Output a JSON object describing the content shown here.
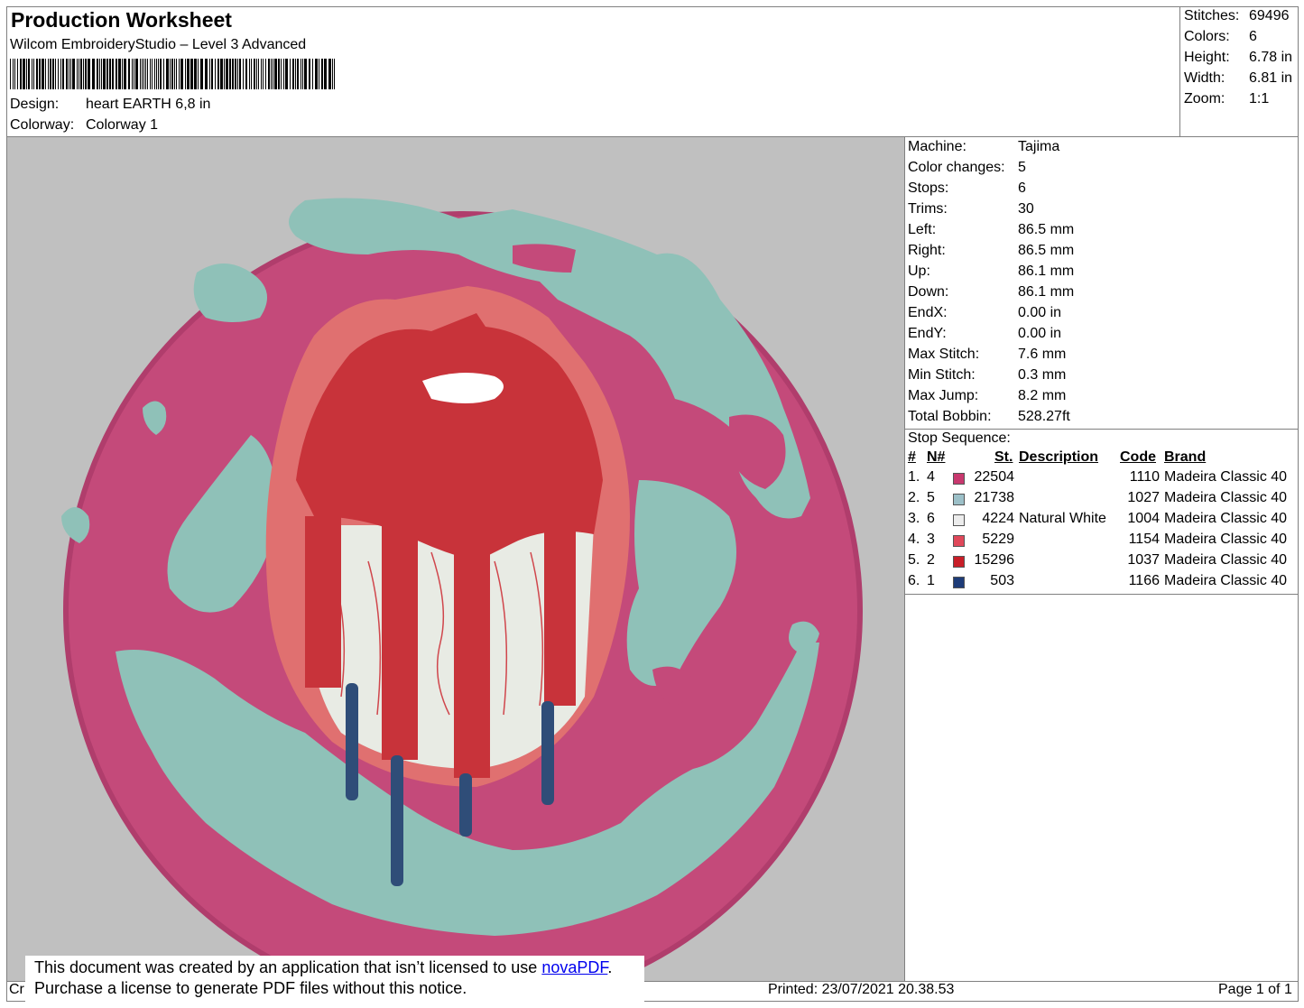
{
  "header": {
    "title": "Production Worksheet",
    "subtitle": "Wilcom EmbroideryStudio – Level 3 Advanced",
    "design_label": "Design:",
    "design_value": "heart EARTH 6,8 in",
    "colorway_label": "Colorway:",
    "colorway_value": "Colorway 1"
  },
  "summary": [
    {
      "label": "Stitches:",
      "value": "69496"
    },
    {
      "label": "Colors:",
      "value": "6"
    },
    {
      "label": "Height:",
      "value": "6.78 in"
    },
    {
      "label": "Width:",
      "value": "6.81 in"
    },
    {
      "label": "Zoom:",
      "value": "1:1"
    }
  ],
  "machine_info": [
    {
      "label": "Machine:",
      "value": "Tajima"
    },
    {
      "label": "Color changes:",
      "value": "5"
    },
    {
      "label": "Stops:",
      "value": "6"
    },
    {
      "label": "Trims:",
      "value": "30"
    },
    {
      "label": "Left:",
      "value": "86.5 mm"
    },
    {
      "label": "Right:",
      "value": "86.5 mm"
    },
    {
      "label": "Up:",
      "value": "86.1 mm"
    },
    {
      "label": "Down:",
      "value": "86.1 mm"
    },
    {
      "label": "EndX:",
      "value": "0.00 in"
    },
    {
      "label": "EndY:",
      "value": "0.00 in"
    },
    {
      "label": "Max Stitch:",
      "value": "7.6 mm"
    },
    {
      "label": "Min Stitch:",
      "value": "0.3 mm"
    },
    {
      "label": "Max Jump:",
      "value": "8.2 mm"
    },
    {
      "label": "Total Bobbin:",
      "value": "528.27ft"
    }
  ],
  "stop_sequence": {
    "label": "Stop Sequence:",
    "headers": {
      "num": "#",
      "n": "N#",
      "st": "St.",
      "description": "Description",
      "code": "Code",
      "brand": "Brand"
    },
    "rows": [
      {
        "num": "1.",
        "n": "4",
        "color": "#c8386e",
        "st": "22504",
        "description": "",
        "code": "1110",
        "brand": "Madeira Classic 40"
      },
      {
        "num": "2.",
        "n": "5",
        "color": "#9cc0c8",
        "st": "21738",
        "description": "",
        "code": "1027",
        "brand": "Madeira Classic 40"
      },
      {
        "num": "3.",
        "n": "6",
        "color": "#ececec",
        "st": "4224",
        "description": "Natural White",
        "code": "1004",
        "brand": "Madeira Classic 40"
      },
      {
        "num": "4.",
        "n": "3",
        "color": "#e0485a",
        "st": "5229",
        "description": "",
        "code": "1154",
        "brand": "Madeira Classic 40"
      },
      {
        "num": "5.",
        "n": "2",
        "color": "#c81e28",
        "st": "15296",
        "description": "",
        "code": "1037",
        "brand": "Madeira Classic 40"
      },
      {
        "num": "6.",
        "n": "1",
        "color": "#1e3c78",
        "st": "503",
        "description": "",
        "code": "1166",
        "brand": "Madeira Classic 40"
      }
    ]
  },
  "footer": {
    "created": "Cr",
    "printed": "Printed: 23/07/2021 20.38.53",
    "page": "Page 1 of 1"
  },
  "notice": {
    "line1_prefix": "This document was created by an application that isn’t licensed to use ",
    "link": "novaPDF",
    "line1_suffix": ".",
    "line2": "Purchase a license to generate PDF files without this notice."
  },
  "colors": {
    "canvas_bg": "#c0c0c0",
    "pink": "#c44a7a",
    "teal": "#8fc1b8",
    "heart_red": "#c8333a",
    "heart_outline": "#e07070",
    "natural_white": "#e8ebe4",
    "navy": "#2f4d78"
  }
}
